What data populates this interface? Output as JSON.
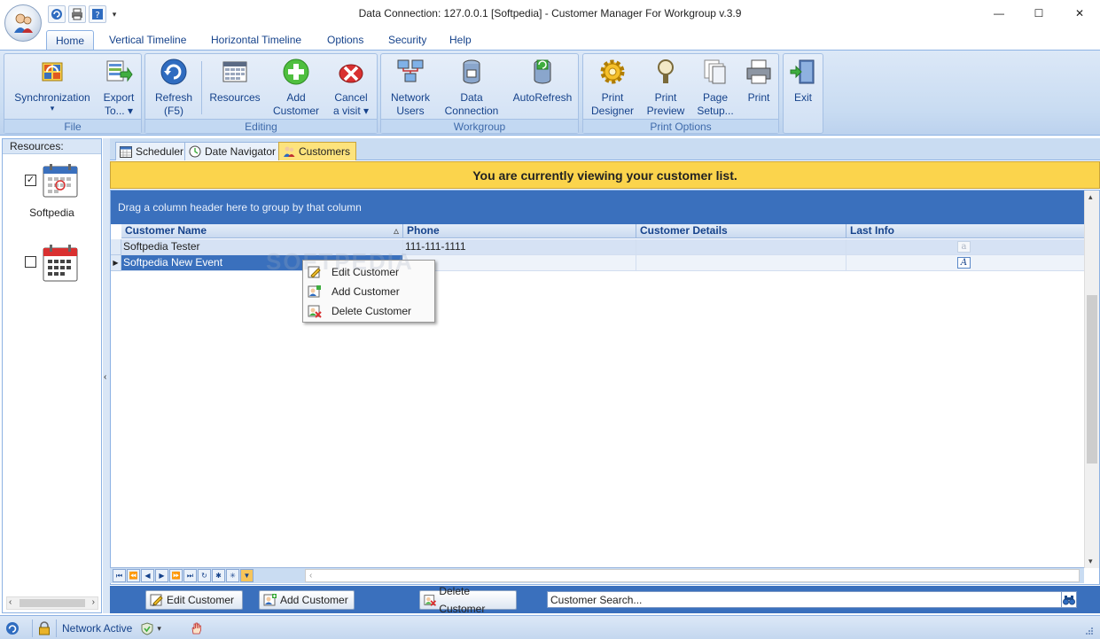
{
  "window": {
    "title": "Data Connection: 127.0.0.1 [Softpedia] - Customer Manager For Workgroup v.3.9",
    "minimize": "—",
    "maximize": "☐",
    "close": "✕"
  },
  "ribbon_tabs": [
    "Home",
    "Vertical Timeline",
    "Horizontal Timeline",
    "Options",
    "Security",
    "Help"
  ],
  "ribbon": {
    "file": {
      "label": "File",
      "sync": "Synchronization",
      "sync_arrow": "▾",
      "export1": "Export",
      "export2": "To... ▾"
    },
    "editing": {
      "label": "Editing",
      "refresh1": "Refresh",
      "refresh2": "(F5)",
      "resources": "Resources",
      "add1": "Add",
      "add2": "Customer",
      "cancel1": "Cancel",
      "cancel2": "a visit ▾"
    },
    "workgroup": {
      "label": "Workgroup",
      "network1": "Network",
      "network2": "Users",
      "data1": "Data",
      "data2": "Connection",
      "autorefresh": "AutoRefresh"
    },
    "print_options": {
      "label": "Print Options",
      "designer1": "Print",
      "designer2": "Designer",
      "preview1": "Print",
      "preview2": "Preview",
      "setup1": "Page",
      "setup2": "Setup...",
      "print": "Print"
    },
    "exit": "Exit"
  },
  "left_panel": {
    "header": "Resources:",
    "resources": [
      {
        "label": "Softpedia",
        "checked": "✓"
      },
      {
        "label": "",
        "checked": ""
      }
    ],
    "collapse_arrow": "‹"
  },
  "doc_tabs": [
    "Scheduler",
    "Date Navigator",
    "Customers"
  ],
  "banner": "You are currently viewing your customer list.",
  "grid": {
    "group_hint": "Drag a column header here to group by that column",
    "columns": [
      "Customer Name",
      "Phone",
      "Customer Details",
      "Last Info"
    ],
    "sort_glyph": "▵",
    "rows": [
      {
        "name": "Softpedia Tester",
        "phone": "111-111-1111",
        "details": "",
        "last_info_icon": "a"
      },
      {
        "name": "Softpedia New Event",
        "phone": "",
        "details": "",
        "last_info_icon": "A"
      }
    ],
    "current_row_marker": "▶"
  },
  "nav_buttons": [
    "⏮",
    "⏪",
    "◀",
    "▶",
    "⏩",
    "⏭",
    "↻",
    "✱",
    "✳",
    "▼"
  ],
  "nav_scroll_arrow": "‹",
  "context_menu": [
    "Edit Customer",
    "Add Customer",
    "Delete Customer"
  ],
  "bottom_bar": {
    "edit": "Edit Customer",
    "add": "Add Customer",
    "delete": "Delete Customer",
    "search_placeholder": "Customer Search..."
  },
  "status_bar": {
    "network": "Network Active",
    "dropdown": "▾"
  },
  "watermark": "SOFTPEDIA",
  "colors": {
    "ribbon_blue": "#c9dcf2",
    "accent_blue": "#3a70bd",
    "banner_yellow": "#fbd44c",
    "text_blue": "#15428b"
  }
}
